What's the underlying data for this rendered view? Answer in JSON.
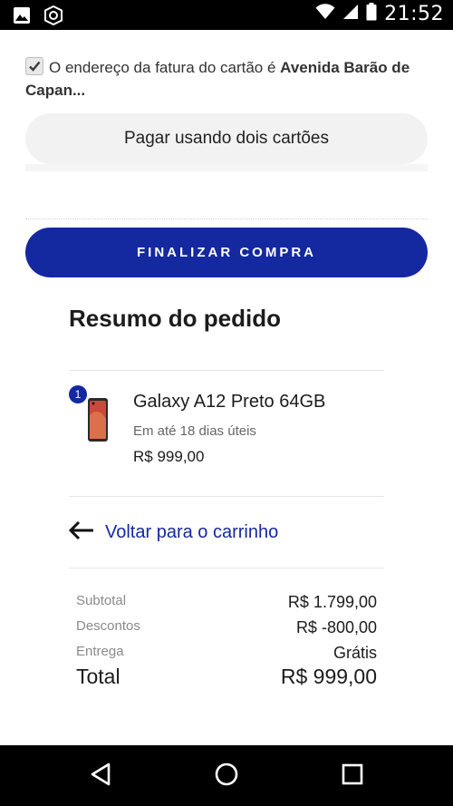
{
  "status_bar": {
    "time": "21:52",
    "icons": [
      "gallery-icon",
      "shield-icon",
      "wifi-icon",
      "signal-icon",
      "battery-icon"
    ]
  },
  "billing": {
    "checked": true,
    "prefix": "O endereço da fatura do cartão é ",
    "address": "Avenida Barão de Capan..."
  },
  "two_cards_label": "Pagar usando dois cartões",
  "finalize_label": "FINALIZAR COMPRA",
  "summary": {
    "title": "Resumo do pedido",
    "item": {
      "quantity": "1",
      "name": "Galaxy A12 Preto 64GB",
      "delivery": "Em até 18 dias úteis",
      "price": "R$ 999,00"
    },
    "back_label": "Voltar para o carrinho",
    "totals": {
      "subtotal_label": "Subtotal",
      "subtotal_value": "R$ 1.799,00",
      "discount_label": "Descontos",
      "discount_value": "R$ -800,00",
      "delivery_label": "Entrega",
      "delivery_value": "Grátis",
      "total_label": "Total",
      "total_value": "R$ 999,00"
    }
  },
  "colors": {
    "brand": "#1428a0",
    "status_bar": "#000000",
    "pill_bg": "#f2f2f2"
  }
}
